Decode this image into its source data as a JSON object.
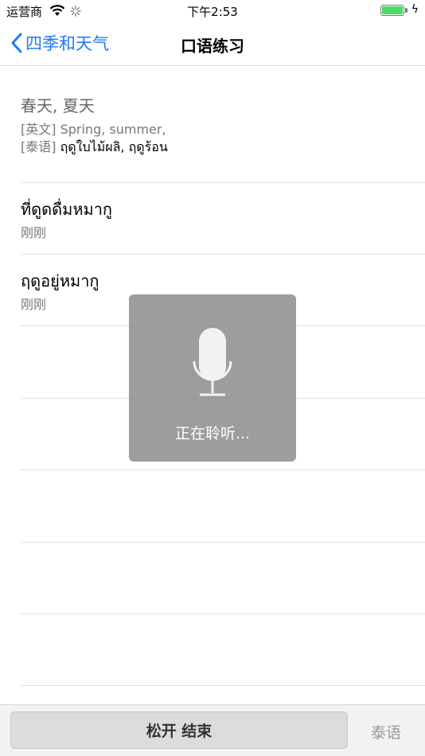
{
  "status_bar": {
    "carrier": "运营商",
    "time": "下午2:53",
    "wifi_icon": "wifi-icon",
    "battery_icon": "battery-icon",
    "charge_symbol": "ϟ"
  },
  "nav": {
    "back_label": "四季和天气",
    "title": "口语练习",
    "accent_color": "#1f7cf2"
  },
  "list": {
    "items": [
      {
        "primary": "春天, 夏天",
        "english_prefix": "[英文]",
        "english": "Spring, summer,",
        "thai_prefix": "[泰语]",
        "thai": "ฤดูใบไม้ผลิ, ฤดูร้อน"
      },
      {
        "primary": "ที่ดูดดื่มหมากู",
        "secondary": "刚刚"
      },
      {
        "primary": "ฤดูอยู่หมากู",
        "secondary": "刚刚"
      }
    ]
  },
  "hud": {
    "icon": "microphone-icon",
    "text": "正在聆听..."
  },
  "bottom_bar": {
    "talk_button": "松开 结束",
    "language_button": "泰语"
  }
}
